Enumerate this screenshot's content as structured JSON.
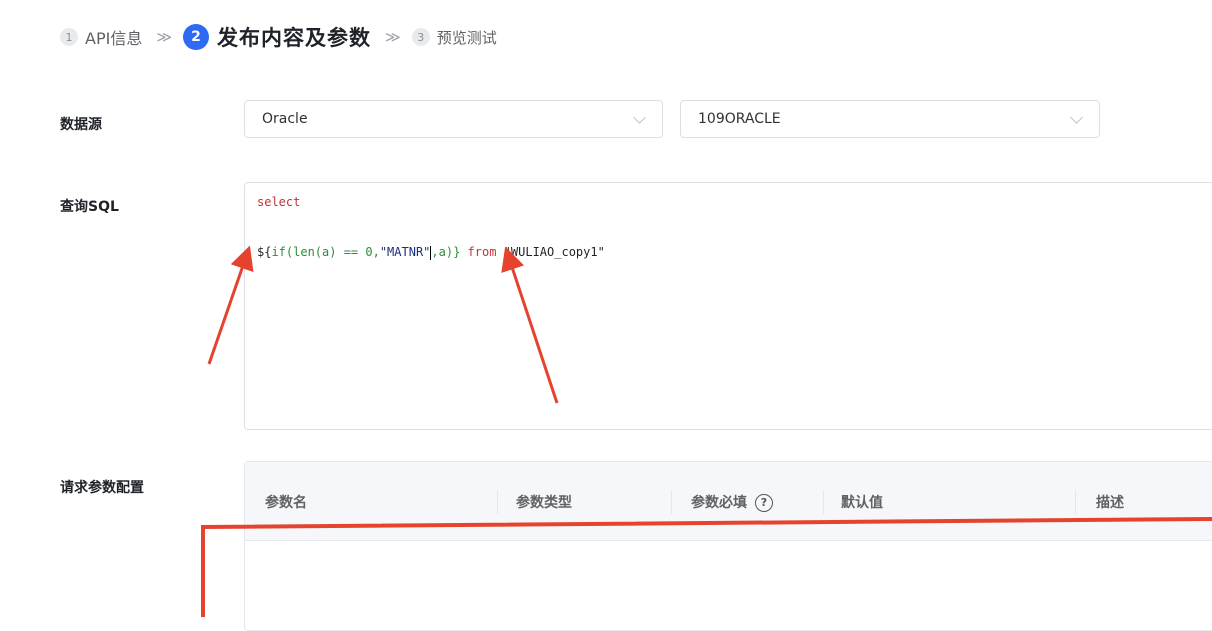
{
  "steps": [
    {
      "num": "1",
      "label": "API信息"
    },
    {
      "num": "2",
      "label": "发布内容及参数"
    },
    {
      "num": "3",
      "label": "预览测试"
    }
  ],
  "step_separator": "≫",
  "datasource": {
    "label": "数据源",
    "type_value": "Oracle",
    "connection_value": "109ORACLE"
  },
  "sql": {
    "label": "查询SQL",
    "line1": "select",
    "line2": {
      "p1": "${",
      "p2": "if(len(a) == 0,",
      "p3": "\"MATNR\"",
      "p4": ",a)}",
      "p5": " from ",
      "p6": "\"WULIAO_copy1\""
    }
  },
  "params": {
    "label": "请求参数配置",
    "columns": [
      "参数名",
      "参数类型",
      "参数必填",
      "默认值",
      "描述"
    ],
    "help_glyph": "?"
  },
  "annotation_color": "#e5432e"
}
